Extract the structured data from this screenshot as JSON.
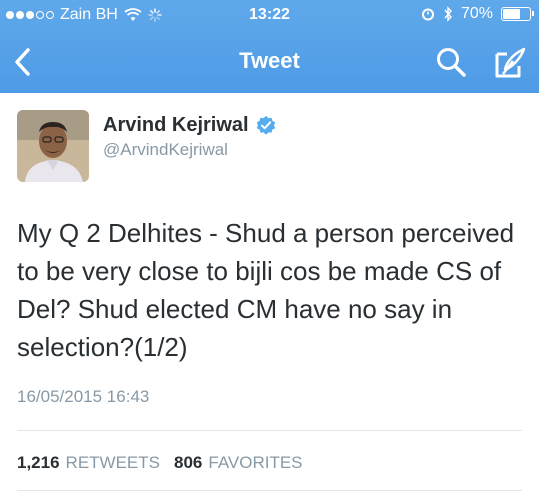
{
  "status_bar": {
    "carrier": "Zain BH",
    "time": "13:22",
    "battery": "70%",
    "battery_level": 0.7
  },
  "nav": {
    "title": "Tweet",
    "back_icon": "chevron-left-icon",
    "search_icon": "search-icon",
    "compose_icon": "compose-icon"
  },
  "tweet": {
    "author_name": "Arvind Kejriwal",
    "author_handle": "@ArvindKejriwal",
    "verified": true,
    "text": "My Q 2 Delhites - Shud a person perceived to be very close to bijli cos be made CS of Del? Shud elected CM have no say in selection?(1/2)",
    "timestamp": "16/05/2015 16:43",
    "retweets_count": "1,216",
    "retweets_label": "RETWEETS",
    "favorites_count": "806",
    "favorites_label": "FAVORITES"
  },
  "colors": {
    "nav_blue": "#55acee",
    "text_dark": "#292f33",
    "text_gray": "#8899a6",
    "verified_blue": "#55acee"
  }
}
